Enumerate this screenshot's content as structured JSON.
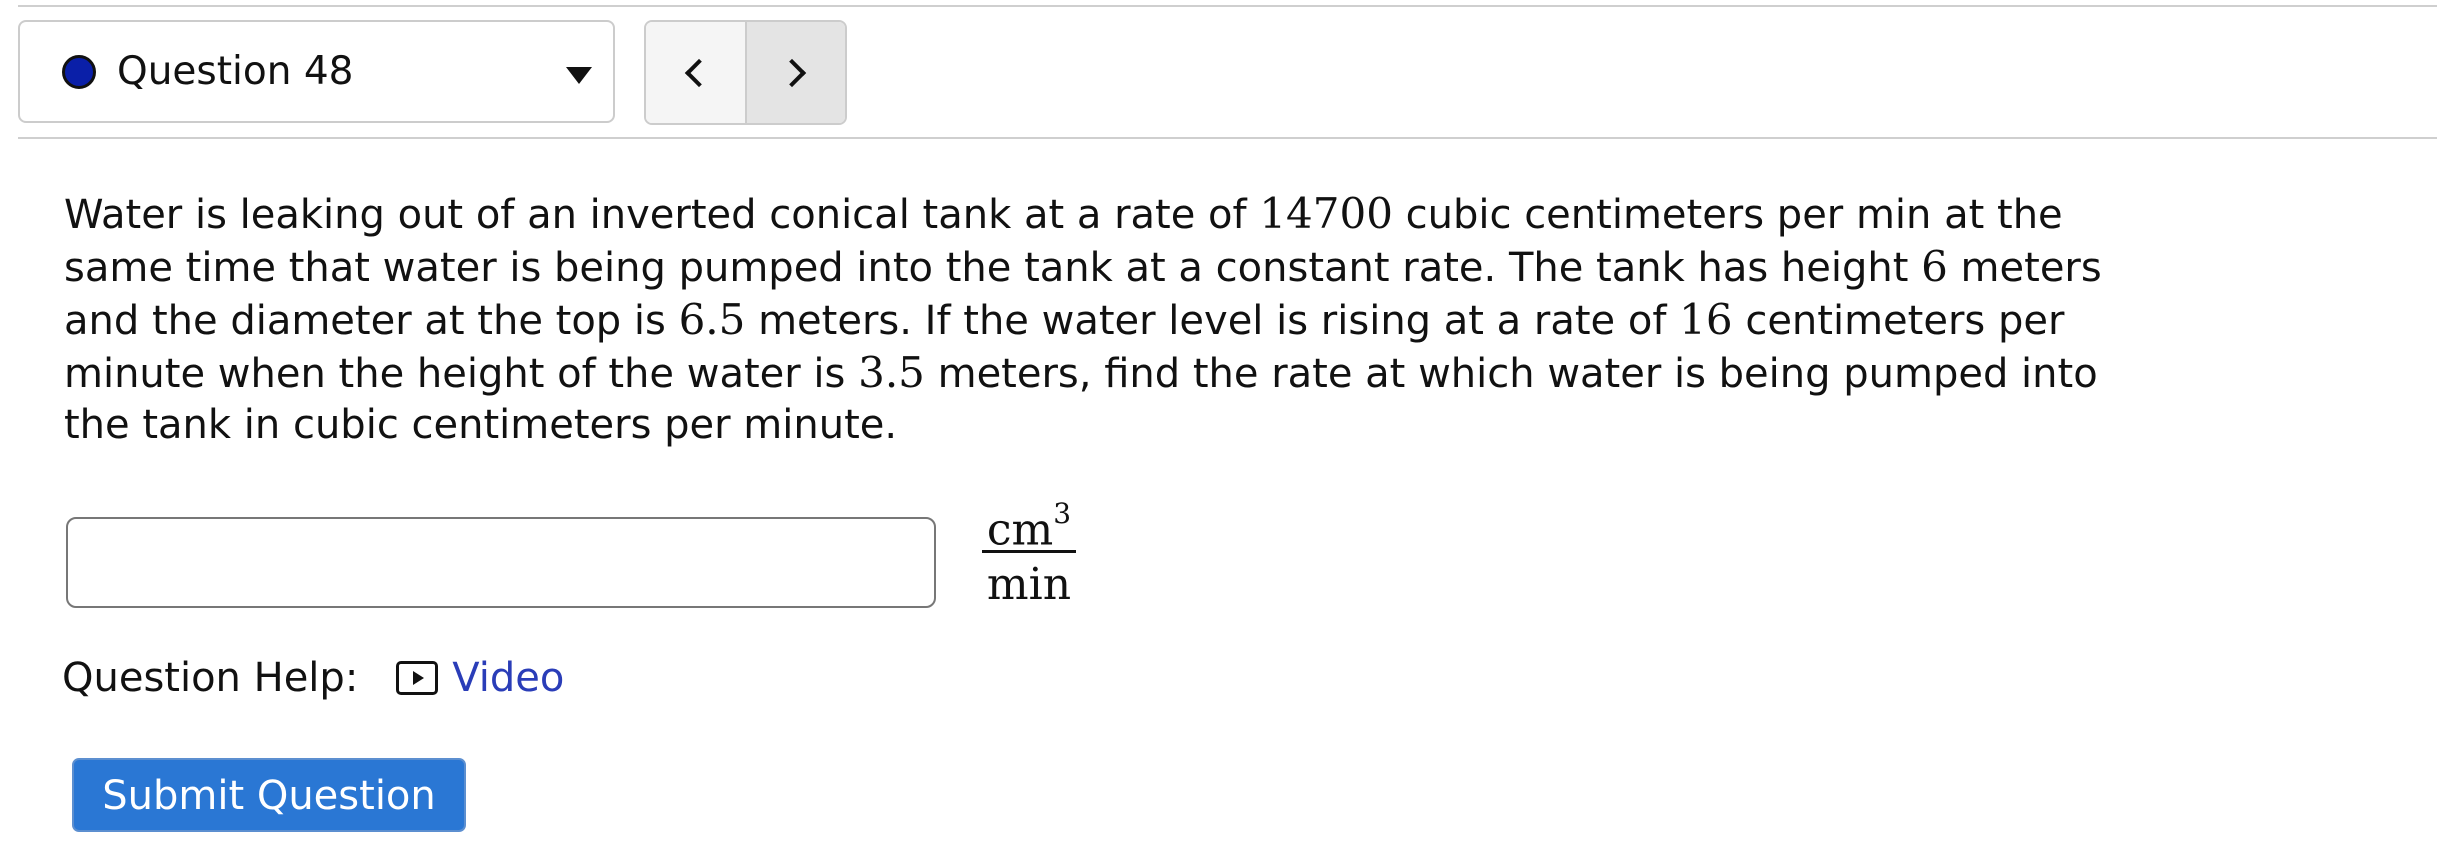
{
  "question_selector": {
    "label": "Question 48",
    "status_color": "#0a1fa8"
  },
  "navigation": {
    "prev_icon": "chevron-left-icon",
    "next_icon": "chevron-right-icon"
  },
  "question": {
    "segments": [
      {
        "t": "Water is leaking out of an inverted conical tank at a rate of "
      },
      {
        "m": "14700"
      },
      {
        "t": " cubic centimeters per min at the same time that water is being pumped into the tank at a constant rate. The tank has height "
      },
      {
        "m": "6"
      },
      {
        "t": " meters and the diameter at the top is "
      },
      {
        "m": "6.5"
      },
      {
        "t": " meters. If the water level is rising at a rate of "
      },
      {
        "m": "16"
      },
      {
        "t": " centimeters per minute when the height of the water is "
      },
      {
        "m": "3.5"
      },
      {
        "t": " meters, find the rate at which water is being pumped into the tank in cubic centimeters per minute."
      }
    ]
  },
  "answer": {
    "value": "",
    "unit_numerator": "cm",
    "unit_exponent": "3",
    "unit_denominator": "min"
  },
  "help": {
    "label": "Question Help:",
    "video_label": "Video",
    "video_icon": "video-play-icon"
  },
  "submit": {
    "label": "Submit Question",
    "color": "#2a77d4"
  },
  "colors": {
    "link": "#2a3db8",
    "border": "#cccccc"
  }
}
